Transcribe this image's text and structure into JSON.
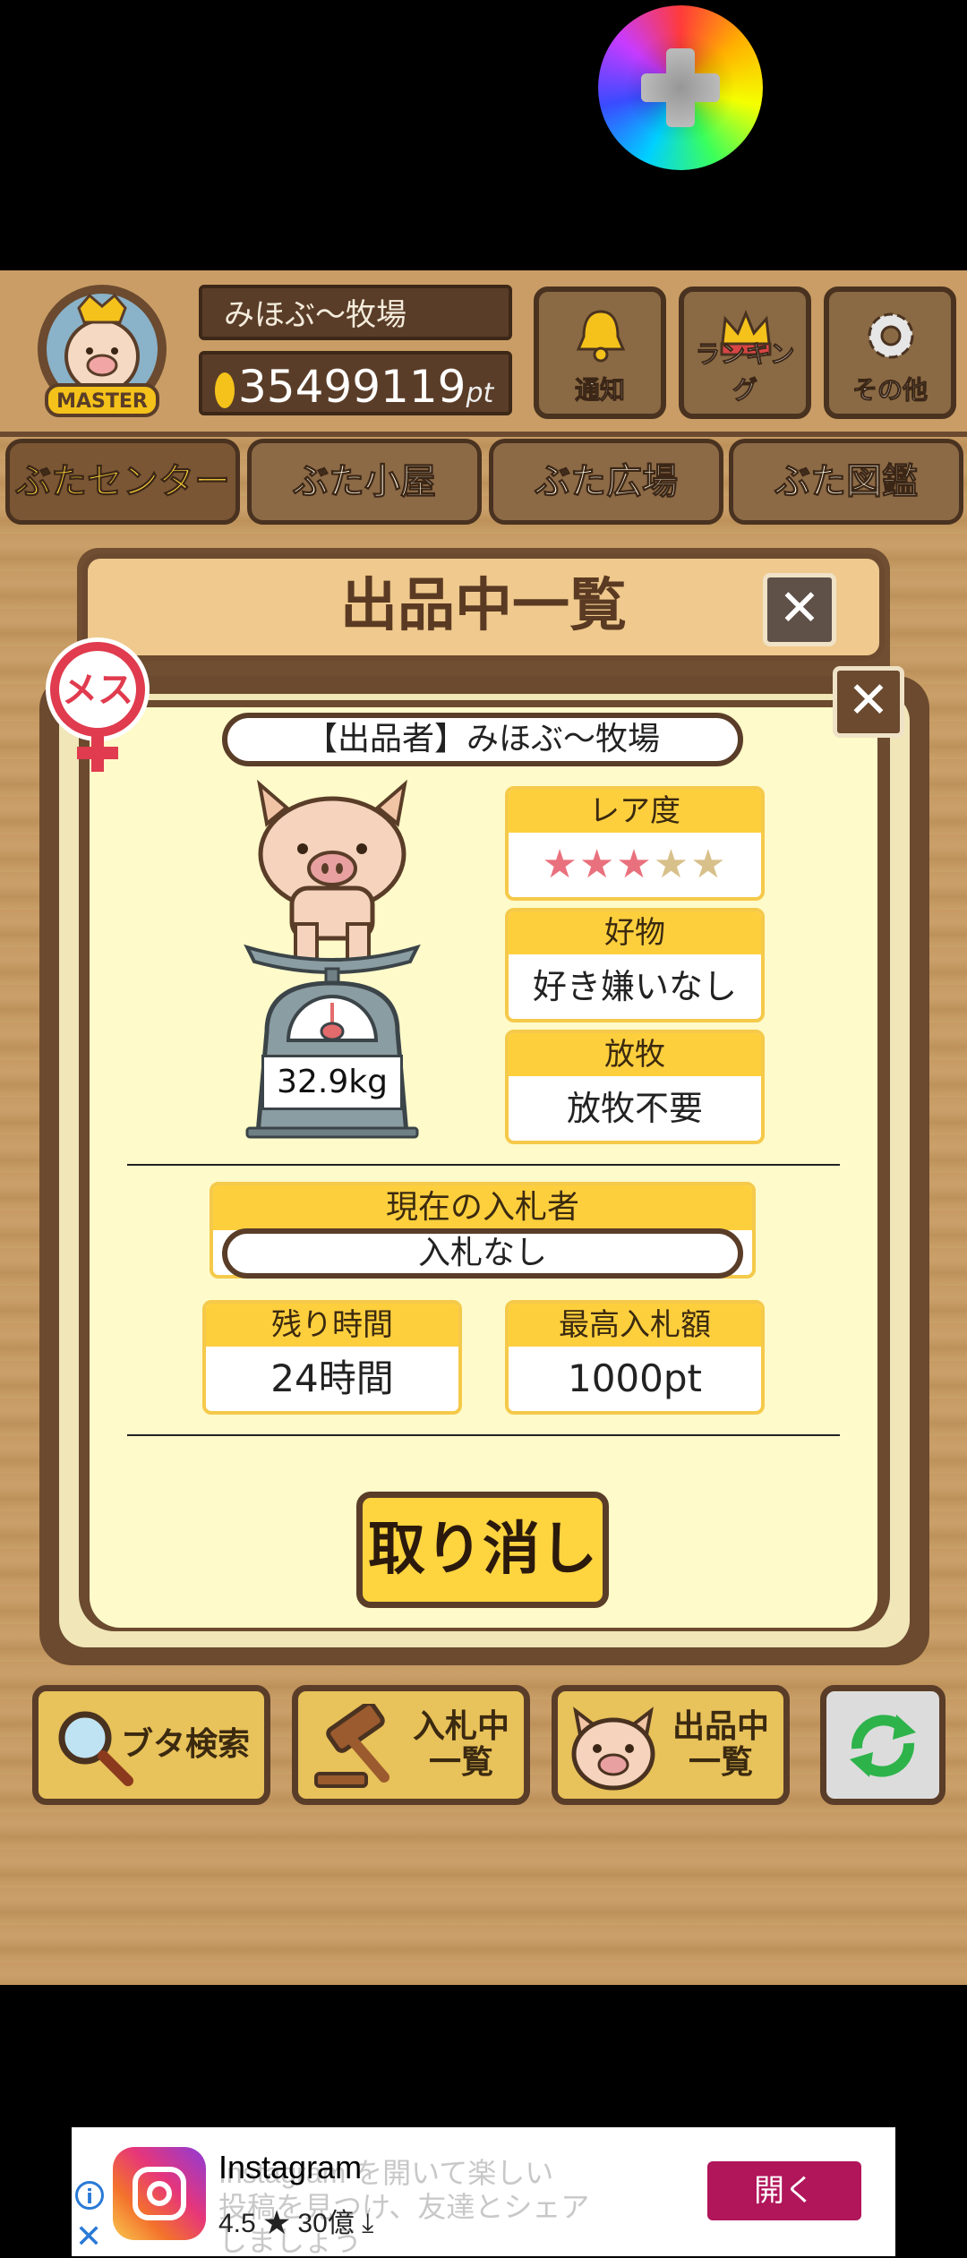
{
  "header": {
    "farm_name": "みほぶ〜牧場",
    "points": "35499119",
    "points_unit": "pt",
    "badge_text": "MASTER",
    "buttons": [
      {
        "label": "通知",
        "icon": "bell-icon"
      },
      {
        "label": "ランキング",
        "icon": "crown-icon"
      },
      {
        "label": "その他",
        "icon": "gear-icon"
      }
    ]
  },
  "tabs": [
    "ぶたセンター",
    "ぶた小屋",
    "ぶた広場",
    "ぶた図鑑"
  ],
  "modal": {
    "title": "出品中一覧",
    "close": "✕"
  },
  "card": {
    "gender": "メス",
    "seller": "【出品者】みほぶ〜牧場",
    "weight": "32.9kg",
    "rarity": {
      "label": "レア度",
      "stars_filled": 3,
      "stars_total": 5,
      "star_on": "★★★",
      "star_off": "★★"
    },
    "favorite": {
      "label": "好物",
      "value": "好き嫌いなし"
    },
    "grazing": {
      "label": "放牧",
      "value": "放牧不要"
    },
    "bidder": {
      "label": "現在の入札者",
      "value": "入札なし"
    },
    "time_left": {
      "label": "残り時間",
      "value": "24時間"
    },
    "max_bid": {
      "label": "最高入札額",
      "value": "1000pt"
    },
    "cancel_label": "取り消し"
  },
  "bottom": [
    {
      "label": "ブタ検索",
      "icon": "magnifier-icon"
    },
    {
      "label": "入札中\n一覧",
      "icon": "gavel-icon"
    },
    {
      "label": "出品中\n一覧",
      "icon": "pig-face-icon"
    },
    {
      "label": "",
      "icon": "refresh-icon"
    }
  ],
  "ad": {
    "app": "Instagram",
    "subtitle": "Instagram を開いて楽しい\n投稿を見つけ、友達とシェア\nしましょう",
    "rating": "4.5",
    "downloads": "30億",
    "cta": "開く",
    "colors": {
      "cta": "#b1155a",
      "info": "#2a7ad6"
    }
  }
}
